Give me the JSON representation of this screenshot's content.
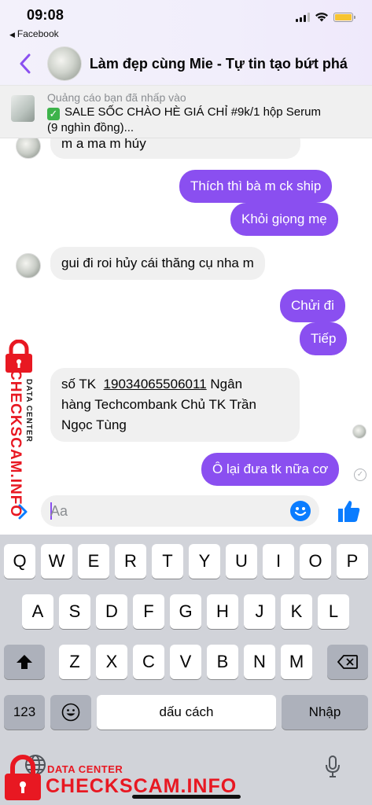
{
  "status_bar": {
    "time": "09:08",
    "back_app": "Facebook",
    "battery_color": "#f7c431"
  },
  "header": {
    "title": "Làm đẹp cùng Mie - Tự tin tạo bứt phá",
    "back_icon": "chevron-left-icon",
    "accent_color": "#8a4ff0"
  },
  "ad": {
    "caption": "Quảng cáo bạn đã nhấp vào",
    "text_line1": "SALE SỐC CHÀO HÈ GIÁ CHỈ #9k/1 hộp Serum",
    "text_line2": "(9 nghìn đồng)..."
  },
  "messages": {
    "m0": "m a ma m hủy",
    "m1": "Thích thì bà m ck ship",
    "m2": "Khỏi giọng mẹ",
    "m3": "gui đi roi hủy cái thăng cụ nha m",
    "m4": "Chửi đi",
    "m5": "Tiếp",
    "m6_prefix": "số TK",
    "m6_account": "19034065506011",
    "m6_line1_suffix": "Ngân",
    "m6_line2": "hàng Techcombank Chủ TK Trần",
    "m6_line3": "Ngọc Tùng",
    "m7": "Ô lại đưa tk nữa cơ"
  },
  "composer": {
    "placeholder": "Aa"
  },
  "keyboard": {
    "row1": [
      "Q",
      "W",
      "E",
      "R",
      "T",
      "Y",
      "U",
      "I",
      "O",
      "P"
    ],
    "row2": [
      "A",
      "S",
      "D",
      "F",
      "G",
      "H",
      "J",
      "K",
      "L"
    ],
    "row3": [
      "Z",
      "X",
      "C",
      "V",
      "B",
      "N",
      "M"
    ],
    "numbers_key": "123",
    "space_key": "dấu cách",
    "return_key": "Nhập"
  },
  "watermark": {
    "brand": "CHECKSCAM.INFO",
    "sub": "DATA CENTER",
    "color": "#e81822"
  }
}
